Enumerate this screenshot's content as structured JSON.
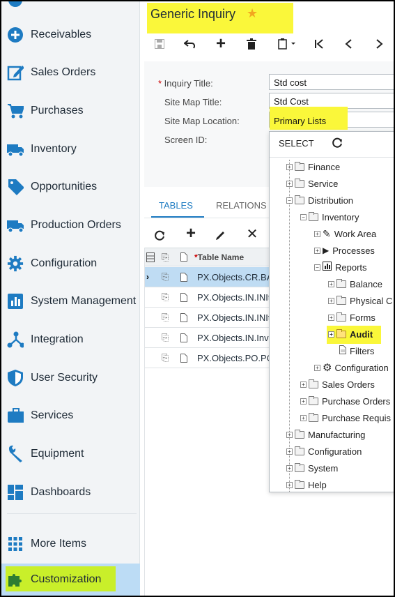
{
  "sidebar": {
    "items": [
      {
        "label": "Receivables",
        "icon": "plus-circle-icon"
      },
      {
        "label": "Sales Orders",
        "icon": "edit-icon"
      },
      {
        "label": "Purchases",
        "icon": "cart-icon"
      },
      {
        "label": "Inventory",
        "icon": "truck-icon"
      },
      {
        "label": "Opportunities",
        "icon": "tag-icon"
      },
      {
        "label": "Production Orders",
        "icon": "truck-icon"
      },
      {
        "label": "Configuration",
        "icon": "gear-icon"
      },
      {
        "label": "System Management",
        "icon": "chart-icon"
      },
      {
        "label": "Integration",
        "icon": "network-icon"
      },
      {
        "label": "User Security",
        "icon": "shield-icon"
      },
      {
        "label": "Services",
        "icon": "briefcase-icon"
      },
      {
        "label": "Equipment",
        "icon": "wrench-icon"
      },
      {
        "label": "Dashboards",
        "icon": "dashboard-icon"
      },
      {
        "label": "More Items",
        "icon": "grid-icon"
      },
      {
        "label": "Customization",
        "icon": "puzzle-icon"
      }
    ]
  },
  "header": {
    "title": "Generic Inquiry"
  },
  "form": {
    "inquiry_title_label": "Inquiry Title:",
    "inquiry_title_value": "Std cost",
    "site_map_title_label": "Site Map Title:",
    "site_map_title_value": "Std Cost",
    "site_map_location_label": "Site Map Location:",
    "site_map_location_value": "Primary Lists",
    "screen_id_label": "Screen ID:"
  },
  "tabs": [
    "TABLES",
    "RELATIONS"
  ],
  "grid": {
    "column_table_name": "Table Name",
    "rows": [
      "PX.Objects.CR.BA",
      "PX.Objects.IN.INIt",
      "PX.Objects.IN.INIt",
      "PX.Objects.IN.Inve",
      "PX.Objects.PO.PO"
    ]
  },
  "dropdown": {
    "select_label": "SELECT",
    "tree": [
      "Finance",
      "Service",
      "Distribution",
      "Inventory",
      "Work Area",
      "Processes",
      "Reports",
      "Balance",
      "Physical C",
      "Forms",
      "Audit",
      "Filters",
      "Configuration",
      "Sales Orders",
      "Purchase Orders",
      "Purchase Requis",
      "Manufacturing",
      "Configuration",
      "System",
      "Help"
    ]
  },
  "colors": {
    "accent": "#1e7bc2",
    "highlight_yellow": "#faf73a",
    "highlight_green": "#c9ef2a",
    "active_nav": "#bcdcf5"
  }
}
